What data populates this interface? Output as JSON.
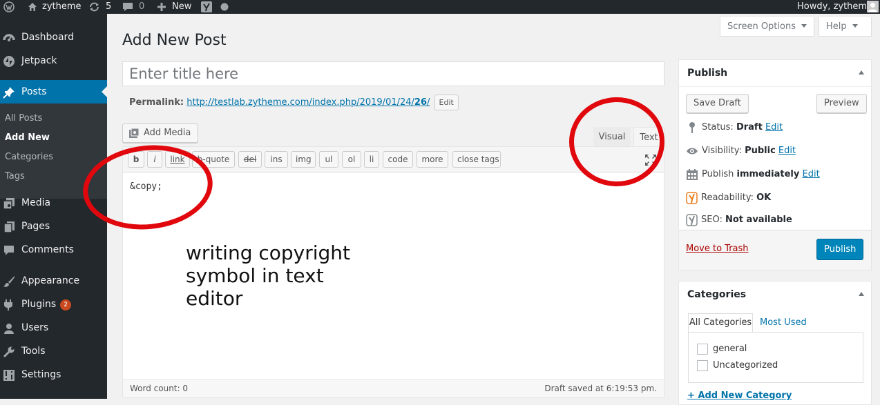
{
  "adminbar": {
    "site_name": "zytheme",
    "updates_count": "5",
    "comments_count": "0",
    "new_label": "New",
    "greeting": "Howdy, zytheme"
  },
  "sidebar": {
    "items": [
      {
        "label": "Dashboard",
        "icon": "dashboard-icon"
      },
      {
        "label": "Jetpack",
        "icon": "jetpack-icon"
      },
      {
        "label": "Posts",
        "icon": "pushpin-icon"
      },
      {
        "label": "Media",
        "icon": "media-icon"
      },
      {
        "label": "Pages",
        "icon": "pages-icon"
      },
      {
        "label": "Comments",
        "icon": "comments-icon"
      },
      {
        "label": "Appearance",
        "icon": "paintbrush-icon"
      },
      {
        "label": "Plugins",
        "icon": "plugins-icon",
        "badge": "2"
      },
      {
        "label": "Users",
        "icon": "users-icon"
      },
      {
        "label": "Tools",
        "icon": "tools-icon"
      },
      {
        "label": "Settings",
        "icon": "settings-icon"
      }
    ],
    "posts_submenu": [
      "All Posts",
      "Add New",
      "Categories",
      "Tags"
    ],
    "active_color": "#0073aa"
  },
  "header": {
    "screen_options": "Screen Options",
    "help": "Help",
    "page_title": "Add New Post"
  },
  "post": {
    "title_placeholder": "Enter title here",
    "permalink_label": "Permalink:",
    "permalink_url": "http://testlab.zytheme.com/index.php/2019/01/24/",
    "permalink_slug": "26",
    "permalink_edit": "Edit"
  },
  "editor": {
    "add_media": "Add Media",
    "tab_visual": "Visual",
    "tab_text": "Text",
    "quicktags": [
      "b",
      "i",
      "link",
      "b-quote",
      "del",
      "ins",
      "img",
      "ul",
      "ol",
      "li",
      "code",
      "more",
      "close tags"
    ],
    "content": "&copy;",
    "word_count": "Word count: 0",
    "draft_saved": "Draft saved at 6:19:53 pm."
  },
  "annotation": {
    "text": "writing copyright\nsymbol in text\neditor",
    "circle_color": "#e0070d"
  },
  "publish_box": {
    "title": "Publish",
    "save_draft": "Save Draft",
    "preview": "Preview",
    "status_label": "Status:",
    "status_value": "Draft",
    "visibility_label": "Visibility:",
    "visibility_value": "Public",
    "publish_label": "Publish",
    "publish_value": "immediately",
    "edit": "Edit",
    "readability_label": "Readability:",
    "readability_value": "OK",
    "seo_label": "SEO:",
    "seo_value": "Not available",
    "move_to_trash": "Move to Trash",
    "publish_button": "Publish"
  },
  "categories_box": {
    "title": "Categories",
    "tab_all": "All Categories",
    "tab_most_used": "Most Used",
    "items": [
      "general",
      "Uncategorized"
    ],
    "add_new": "+ Add New Category"
  }
}
